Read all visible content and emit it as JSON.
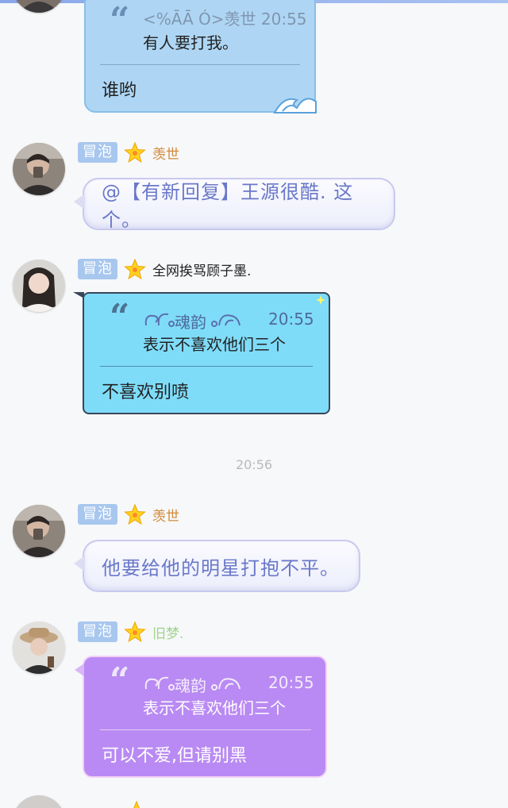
{
  "messages": [
    {
      "quote_head": "<%ĀĀ Ó>羡世 20:55",
      "quote_text": "有人要打我。",
      "reply": "谁哟"
    },
    {
      "tag": "冒泡",
      "nick": "羡世",
      "text": "@【有新回复】王源很酷. 这个。"
    },
    {
      "tag": "冒泡",
      "nick": "全网挨骂顾子墨.",
      "quote_head": "魂韵",
      "quote_time": "20:55",
      "quote_text": "表示不喜欢他们三个",
      "reply": "不喜欢别喷"
    },
    {
      "tag": "冒泡",
      "nick": "羡世",
      "text": "他要给他的明星打抱不平。"
    },
    {
      "tag": "冒泡",
      "nick": "旧梦.",
      "quote_head": "魂韵",
      "quote_time": "20:55",
      "quote_text": "表示不喜欢他们三个",
      "reply": "可以不爱,但请别黑"
    }
  ],
  "timestamp": "20:56",
  "quote_glyph": "“",
  "colors": {
    "tag_bg": "#a8c7ee",
    "nick_orange": "#d28a3a",
    "nick_black": "#222222",
    "nick_green": "#9fd48c",
    "bubble_blue": "#aed6f4",
    "bubble_cyan": "#7fdcf9",
    "bubble_purple": "#b98af3",
    "pill_text": "#6a78c8"
  },
  "icons": [
    "star-icon",
    "wave-icon",
    "swirl-icon",
    "sparkle-icon"
  ]
}
